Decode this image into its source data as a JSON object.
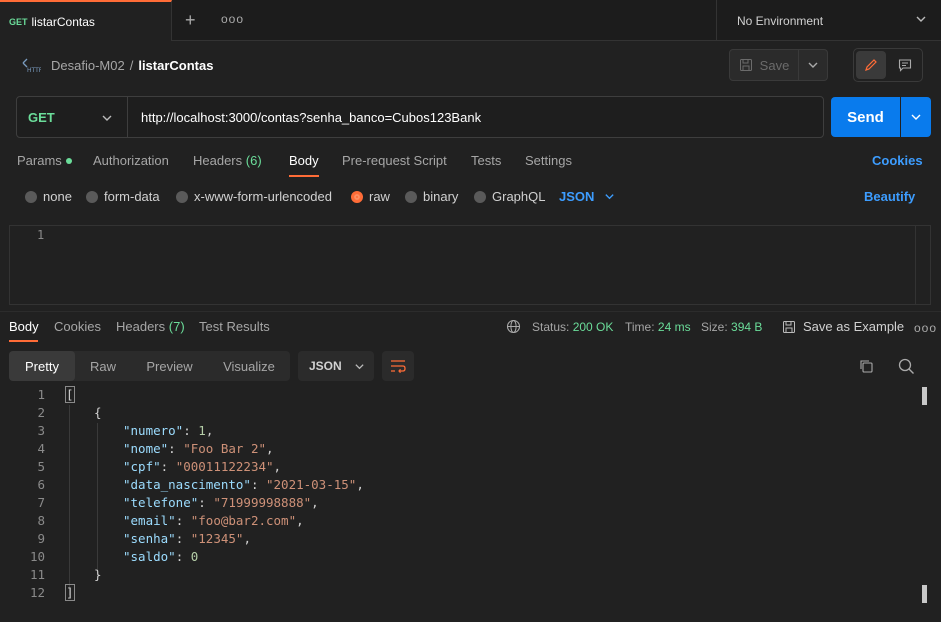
{
  "tab": {
    "method": "GET",
    "title": "listarContas",
    "plus": "+",
    "more": "ooo"
  },
  "environment": {
    "label": "No Environment"
  },
  "breadcrumb": {
    "parent": "Desafio-M02",
    "separator": "/",
    "current": "listarContas"
  },
  "save": {
    "label": "Save"
  },
  "request": {
    "method": "GET",
    "url": "http://localhost:3000/contas?senha_banco=Cubos123Bank",
    "send_label": "Send"
  },
  "request_tabs": {
    "params": "Params",
    "authorization": "Authorization",
    "headers": "Headers",
    "headers_count": "(6)",
    "body": "Body",
    "prerequest": "Pre-request Script",
    "tests": "Tests",
    "settings": "Settings",
    "cookies": "Cookies"
  },
  "body_types": {
    "none": "none",
    "form_data": "form-data",
    "urlencoded": "x-www-form-urlencoded",
    "raw": "raw",
    "binary": "binary",
    "graphql": "GraphQL",
    "format": "JSON",
    "beautify": "Beautify",
    "selected": "raw"
  },
  "request_editor": {
    "line": "1"
  },
  "response_tabs": {
    "body": "Body",
    "cookies": "Cookies",
    "headers": "Headers",
    "headers_count": "(7)",
    "test_results": "Test Results"
  },
  "status": {
    "status_label": "Status:",
    "status_value": "200 OK",
    "time_label": "Time:",
    "time_value": "24 ms",
    "size_label": "Size:",
    "size_value": "394 B",
    "save_example": "Save as Example",
    "more": "ooo"
  },
  "view_modes": {
    "pretty": "Pretty",
    "raw": "Raw",
    "preview": "Preview",
    "visualize": "Visualize",
    "format": "JSON"
  },
  "response_code": {
    "line_numbers": [
      "1",
      "2",
      "3",
      "4",
      "5",
      "6",
      "7",
      "8",
      "9",
      "10",
      "11",
      "12"
    ],
    "open_bracket": "[",
    "open_brace": "{",
    "fields": [
      {
        "key": "\"numero\"",
        "value": "1",
        "kind": "n",
        "comma": ","
      },
      {
        "key": "\"nome\"",
        "value": "\"Foo Bar 2\"",
        "kind": "s",
        "comma": ","
      },
      {
        "key": "\"cpf\"",
        "value": "\"00011122234\"",
        "kind": "s",
        "comma": ","
      },
      {
        "key": "\"data_nascimento\"",
        "value": "\"2021-03-15\"",
        "kind": "s",
        "comma": ","
      },
      {
        "key": "\"telefone\"",
        "value": "\"71999998888\"",
        "kind": "s",
        "comma": ","
      },
      {
        "key": "\"email\"",
        "value": "\"foo@bar2.com\"",
        "kind": "s",
        "comma": ","
      },
      {
        "key": "\"senha\"",
        "value": "\"12345\"",
        "kind": "s",
        "comma": ","
      },
      {
        "key": "\"saldo\"",
        "value": "0",
        "kind": "n",
        "comma": ""
      }
    ],
    "close_brace": "}",
    "close_bracket": "]",
    "colon": ": "
  },
  "colors": {
    "accent": "#ff6c37",
    "send": "#097bed",
    "link": "#3d9dff",
    "success": "#6bdd9a"
  }
}
